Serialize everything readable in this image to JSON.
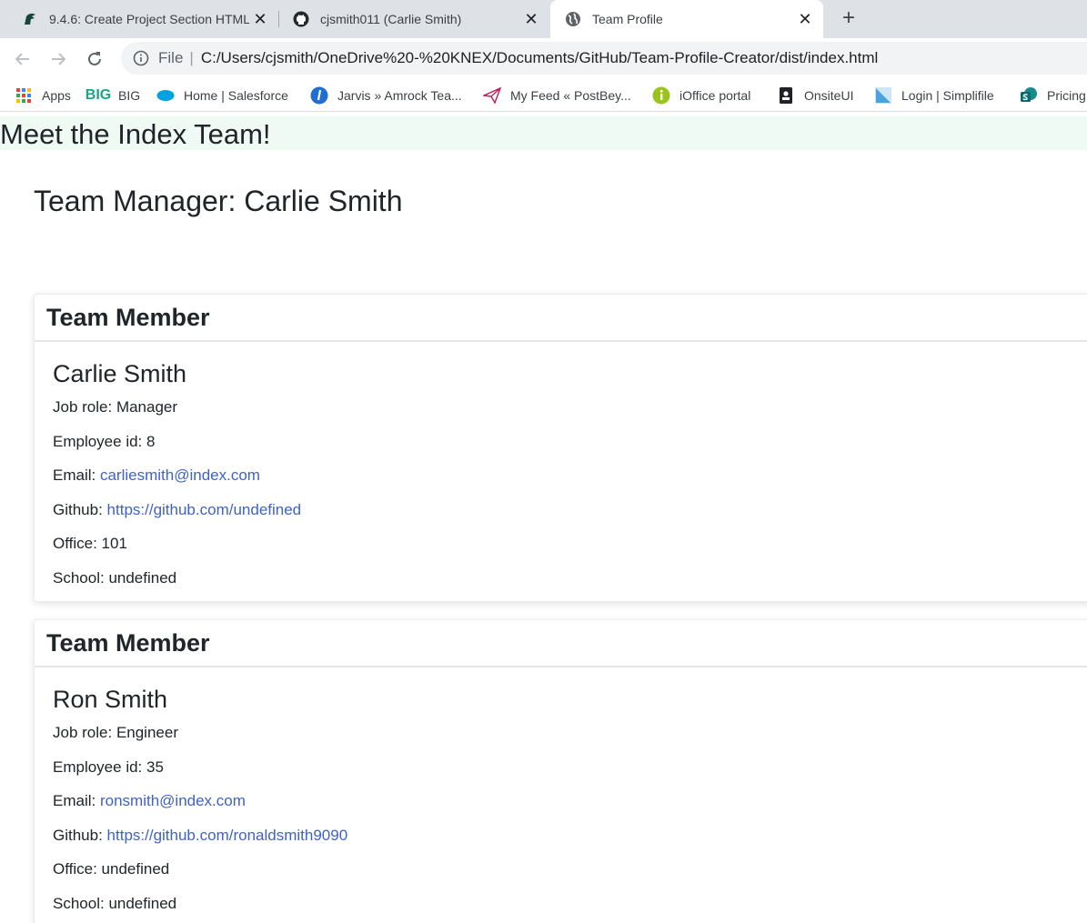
{
  "browser": {
    "tabs": [
      {
        "title": "9.4.6: Create Project Section HTML",
        "favicon": "spartan-helmet-icon"
      },
      {
        "title": "cjsmith011 (Carlie Smith)",
        "favicon": "github-icon"
      },
      {
        "title": "Team Profile",
        "favicon": "globe-icon"
      }
    ],
    "address": {
      "prefix": "File",
      "url": "C:/Users/cjsmith/OneDrive%20-%20KNEX/Documents/GitHub/Team-Profile-Creator/dist/index.html"
    },
    "bookmarks": [
      {
        "label": "Apps",
        "icon": "apps-grid-icon"
      },
      {
        "label": "BIG",
        "icon": "big-logo-icon"
      },
      {
        "label": "Home | Salesforce",
        "icon": "salesforce-cloud-icon"
      },
      {
        "label": "Jarvis » Amrock Tea...",
        "icon": "jarvis-icon"
      },
      {
        "label": "My Feed « PostBey...",
        "icon": "paper-plane-icon"
      },
      {
        "label": "iOffice portal",
        "icon": "info-circle-icon"
      },
      {
        "label": "OnsiteUI",
        "icon": "badge-icon"
      },
      {
        "label": "Login | Simplifile",
        "icon": "simplifile-icon"
      },
      {
        "label": "Pricing",
        "icon": "sharepoint-icon"
      }
    ]
  },
  "page": {
    "hero_title": "Meet the Index Team!",
    "manager_heading": "Team Manager: Carlie Smith",
    "cards": [
      {
        "header": "Team Member",
        "name": "Carlie Smith",
        "job_label": "Job role: ",
        "job": "Manager",
        "id_label": "Employee id: ",
        "id": "8",
        "email_label": "Email: ",
        "email": "carliesmith@index.com",
        "github_label": "Github: ",
        "github": "https://github.com/undefined",
        "office_label": "Office: ",
        "office": "101",
        "school_label": "School: ",
        "school": "undefined"
      },
      {
        "header": "Team Member",
        "name": "Ron Smith",
        "job_label": "Job role: ",
        "job": "Engineer",
        "id_label": "Employee id: ",
        "id": "35",
        "email_label": "Email: ",
        "email": "ronsmith@index.com",
        "github_label": "Github: ",
        "github": "https://github.com/ronaldsmith9090",
        "office_label": "Office: ",
        "office": "undefined",
        "school_label": "School: ",
        "school": "undefined"
      }
    ]
  },
  "colors": {
    "link": "#3f62c9",
    "hero_bg": "#effaf4",
    "tabstrip": "#dee1e6"
  }
}
